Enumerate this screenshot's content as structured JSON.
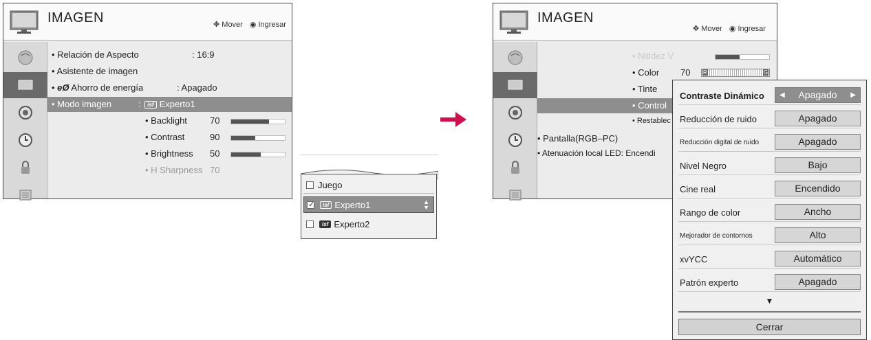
{
  "left_panel": {
    "title": "IMAGEN",
    "hint_move": "Mover",
    "hint_enter": "Ingresar",
    "rows": [
      {
        "label": "• Relación de Aspecto",
        "value": ": 16:9"
      },
      {
        "label": "• Asistente de imagen"
      },
      {
        "label": "• ",
        "label2": " Ahorro de energía",
        "value": ": Apagado"
      },
      {
        "label": "• Modo imagen",
        "value_prefix": ":",
        "value": "Experto1",
        "badge": "isf"
      },
      {
        "label": "• Backlight",
        "value": "70",
        "level": 0.7
      },
      {
        "label": "• Contrast",
        "value": "90",
        "level": 0.45
      },
      {
        "label": "• Brightness",
        "value": "50",
        "level": 0.55
      },
      {
        "label": "• H Sharpness",
        "value": "70"
      }
    ]
  },
  "popup": {
    "items": [
      {
        "label": "Juego",
        "checked": false
      },
      {
        "label": "Experto1",
        "checked": true,
        "badge": "isf"
      },
      {
        "label": "Experto2",
        "checked": false,
        "badge": "isf"
      }
    ]
  },
  "right_panel": {
    "title": "IMAGEN",
    "hint_move": "Mover",
    "hint_enter": "Ingresar",
    "rows": [
      {
        "label": "• Nitidez V",
        "level": 0.45
      },
      {
        "label": "• Color",
        "value": "70",
        "gauge_left": "R",
        "gauge_right": "G"
      },
      {
        "label": "• Tinte"
      },
      {
        "label": "• Control"
      },
      {
        "label": "• Restablec"
      },
      {
        "label": "• Pantalla(RGB–PC)"
      },
      {
        "label": "• Atenuación local LED: Encendi"
      }
    ]
  },
  "advanced_dialog": {
    "rows": [
      {
        "label": "Contraste Dinámico",
        "value": "Apagado",
        "selected": true
      },
      {
        "label": "Reducción de ruido",
        "value": "Apagado"
      },
      {
        "label": "Reducción digital de ruido",
        "value": "Apagado",
        "small": true
      },
      {
        "label": "Nivel Negro",
        "value": "Bajo"
      },
      {
        "label": "Cine real",
        "value": "Encendido"
      },
      {
        "label": "Rango de color",
        "value": "Ancho"
      },
      {
        "label": "Mejorador de contornos",
        "value": "Alto",
        "small": true
      },
      {
        "label": "xvYCC",
        "value": "Automático"
      },
      {
        "label": "Patrón experto",
        "value": "Apagado"
      }
    ],
    "more_indicator": "▼",
    "close_label": "Cerrar"
  },
  "colors": {
    "arrow": "#d0104c",
    "selection": "#8e8e8e"
  }
}
